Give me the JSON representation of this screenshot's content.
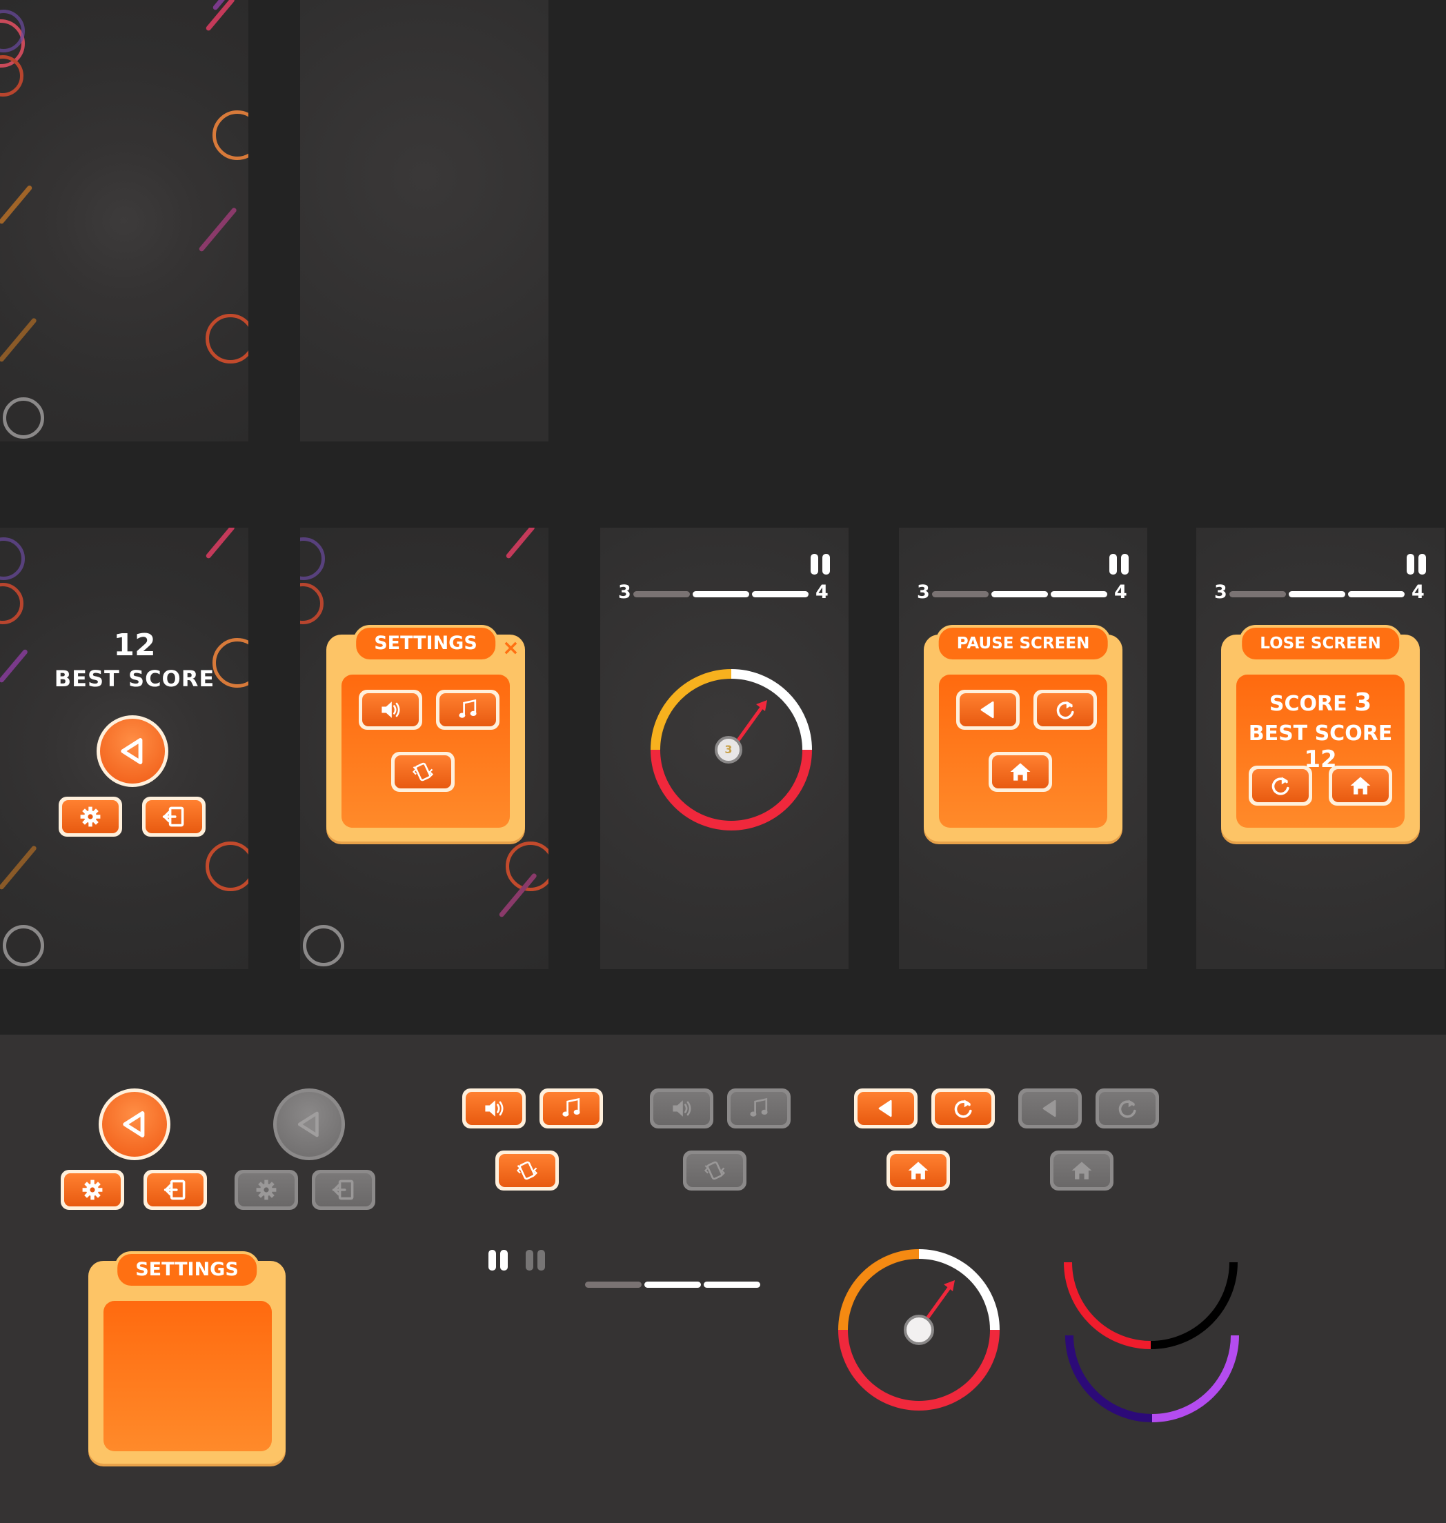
{
  "colors": {
    "accent": "#ff7012",
    "panel": "#fdc466",
    "dial_yellow": "#f7b11e",
    "dial_red": "#f0283c",
    "dial_white": "#ffffff",
    "needle": "#f0283c",
    "disabled": "#7a7878"
  },
  "menu": {
    "score_value": "12",
    "score_label": "BEST SCORE"
  },
  "settings": {
    "title": "SETTINGS",
    "close_icon": "×"
  },
  "game": {
    "level_from": "3",
    "level_to": "4",
    "progress_segments_done": 2,
    "progress_segments_total": 3,
    "ball_number": "3"
  },
  "pause_screen": {
    "title": "PAUSE SCREEN",
    "level_from": "3",
    "level_to": "4"
  },
  "lose_screen": {
    "title": "LOSE SCREEN",
    "level_from": "3",
    "level_to": "4",
    "score_label": "SCORE",
    "score_value": "3",
    "best_label": "BEST SCORE",
    "best_value": "12"
  },
  "kit": {
    "settings_title": "SETTINGS"
  },
  "icons": [
    "play-icon",
    "gear-icon",
    "exit-icon",
    "sound-icon",
    "music-icon",
    "vibration-icon",
    "back-icon",
    "restart-icon",
    "home-icon",
    "pause-icon",
    "close-icon"
  ]
}
